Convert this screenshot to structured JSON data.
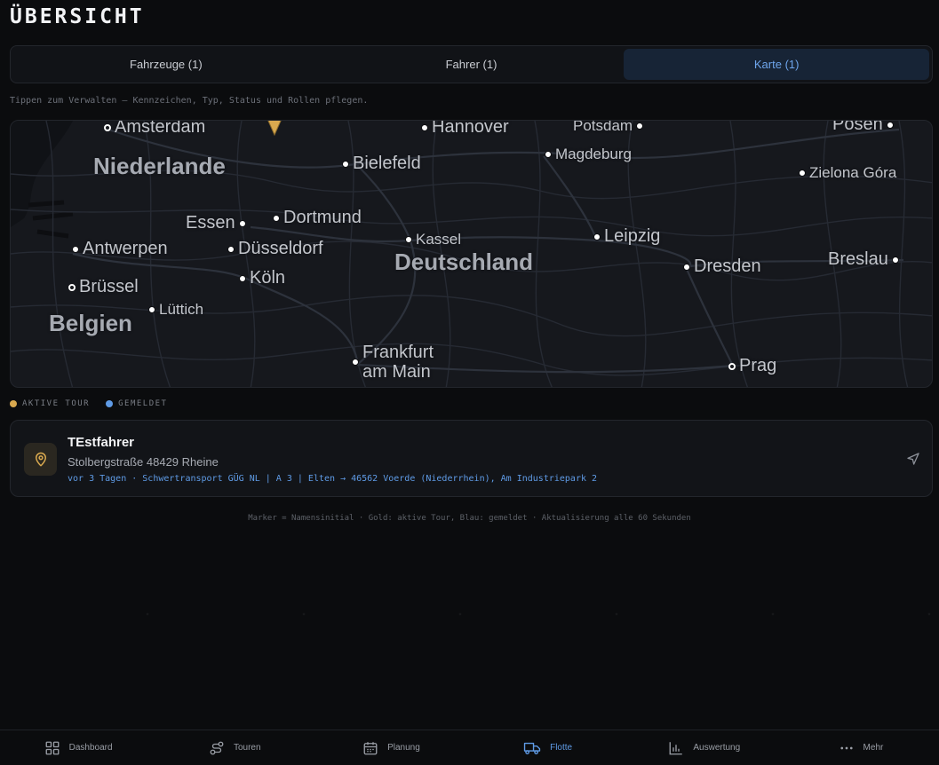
{
  "header": {
    "title": "ÜBERSICHT"
  },
  "tabs": [
    {
      "label": "Fahrzeuge (1)",
      "active": false
    },
    {
      "label": "Fahrer (1)",
      "active": false
    },
    {
      "label": "Karte (1)",
      "active": true
    }
  ],
  "hint": "Tippen zum Verwalten — Kennzeichen, Typ, Status und Rollen pflegen.",
  "map": {
    "countries": [
      "Niederlande",
      "Deutschland",
      "Belgien"
    ],
    "cities": [
      "Amsterdam",
      "Hannover",
      "Potsdam",
      "Posen",
      "Bielefeld",
      "Magdeburg",
      "Zielona Góra",
      "Essen",
      "Dortmund",
      "Antwerpen",
      "Düsseldorf",
      "Kassel",
      "Leipzig",
      "Dresden",
      "Breslau",
      "Köln",
      "Brüssel",
      "Lüttich",
      "Frankfurt",
      "am Main",
      "Prag"
    ],
    "marker_color": "#d9a94f"
  },
  "legend": {
    "active_tour": "AKTIVE TOUR",
    "reported": "GEMELDET",
    "active_color": "#d9a94f",
    "reported_color": "#5f9be6"
  },
  "driver": {
    "name": "TEstfahrer",
    "address": "Stolbergstraße 48429 Rheine",
    "tour": "vor 3 Tagen · Schwertransport GÜG NL | A 3 | Elten → 46562 Voerde (Niederrhein), Am Industriepark 2"
  },
  "footnote": "Marker = Namensinitial · Gold: aktive Tour, Blau: gemeldet · Aktualisierung alle 60 Sekunden",
  "bottom_nav": [
    {
      "label": "Dashboard",
      "icon": "grid-icon"
    },
    {
      "label": "Touren",
      "icon": "route-icon"
    },
    {
      "label": "Planung",
      "icon": "calendar-icon"
    },
    {
      "label": "Flotte",
      "icon": "truck-icon",
      "active": true
    },
    {
      "label": "Auswertung",
      "icon": "bar-chart-icon"
    },
    {
      "label": "Mehr",
      "icon": "more-icon"
    }
  ]
}
